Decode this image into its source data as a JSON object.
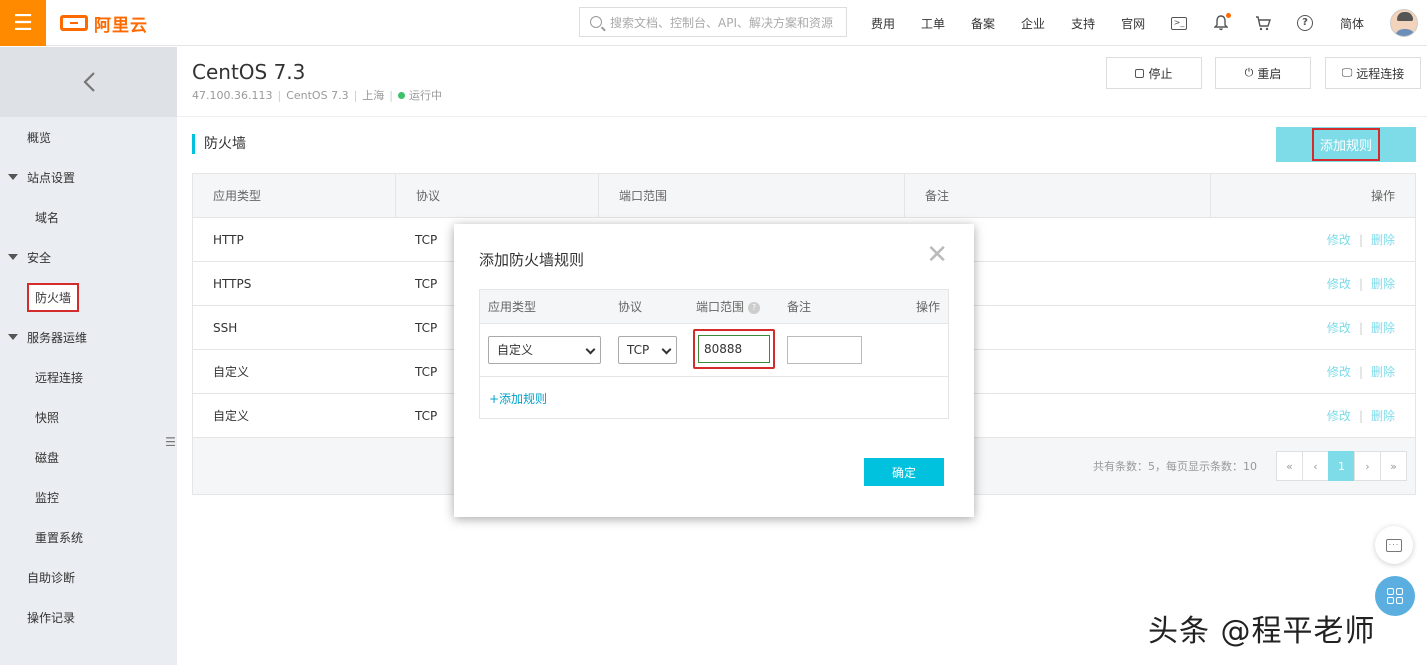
{
  "topbar": {
    "logo_text": "阿里云",
    "search_placeholder": "搜索文档、控制台、API、解决方案和资源",
    "links": [
      "费用",
      "工单",
      "备案",
      "企业",
      "支持",
      "官网"
    ],
    "lang": "简体",
    "accent_color": "#ff6a00"
  },
  "sidebar": {
    "items": [
      {
        "label": "概览",
        "level": 1,
        "group": false
      },
      {
        "label": "站点设置",
        "level": 1,
        "group": true
      },
      {
        "label": "域名",
        "level": 2,
        "group": false
      },
      {
        "label": "安全",
        "level": 1,
        "group": true
      },
      {
        "label": "防火墙",
        "level": 2,
        "group": false,
        "active": true
      },
      {
        "label": "服务器运维",
        "level": 1,
        "group": true
      },
      {
        "label": "远程连接",
        "level": 2,
        "group": false
      },
      {
        "label": "快照",
        "level": 2,
        "group": false
      },
      {
        "label": "磁盘",
        "level": 2,
        "group": false
      },
      {
        "label": "监控",
        "level": 2,
        "group": false
      },
      {
        "label": "重置系统",
        "level": 2,
        "group": false
      },
      {
        "label": "自助诊断",
        "level": 1,
        "group": false
      },
      {
        "label": "操作记录",
        "level": 1,
        "group": false
      }
    ]
  },
  "header": {
    "title": "CentOS 7.3",
    "ip": "47.100.36.113",
    "os": "CentOS 7.3",
    "region": "上海",
    "status": "运行中",
    "buttons": {
      "stop": "停止",
      "restart": "重启",
      "remote": "远程连接"
    }
  },
  "firewall": {
    "section_title": "防火墙",
    "add_rule_label": "添加规则",
    "columns": [
      "应用类型",
      "协议",
      "端口范围",
      "备注",
      "操作"
    ],
    "rows": [
      {
        "app": "HTTP",
        "protocol": "TCP"
      },
      {
        "app": "HTTPS",
        "protocol": "TCP"
      },
      {
        "app": "SSH",
        "protocol": "TCP"
      },
      {
        "app": "自定义",
        "protocol": "TCP"
      },
      {
        "app": "自定义",
        "protocol": "TCP"
      }
    ],
    "op_edit": "修改",
    "op_delete": "删除",
    "pager_text": "共有条数：5，每页显示条数：10",
    "pager": {
      "first": "«",
      "prev": "‹",
      "current": "1",
      "next": "›",
      "last": "»"
    }
  },
  "modal": {
    "title": "添加防火墙规则",
    "columns": {
      "app": "应用类型",
      "protocol": "协议",
      "port": "端口范围",
      "note": "备注",
      "ops": "操作"
    },
    "app_value": "自定义",
    "protocol_value": "TCP",
    "port_value": "80888",
    "note_value": "",
    "add_link": "+添加规则",
    "ok_label": "确定"
  },
  "watermark": "头条 @程平老师"
}
